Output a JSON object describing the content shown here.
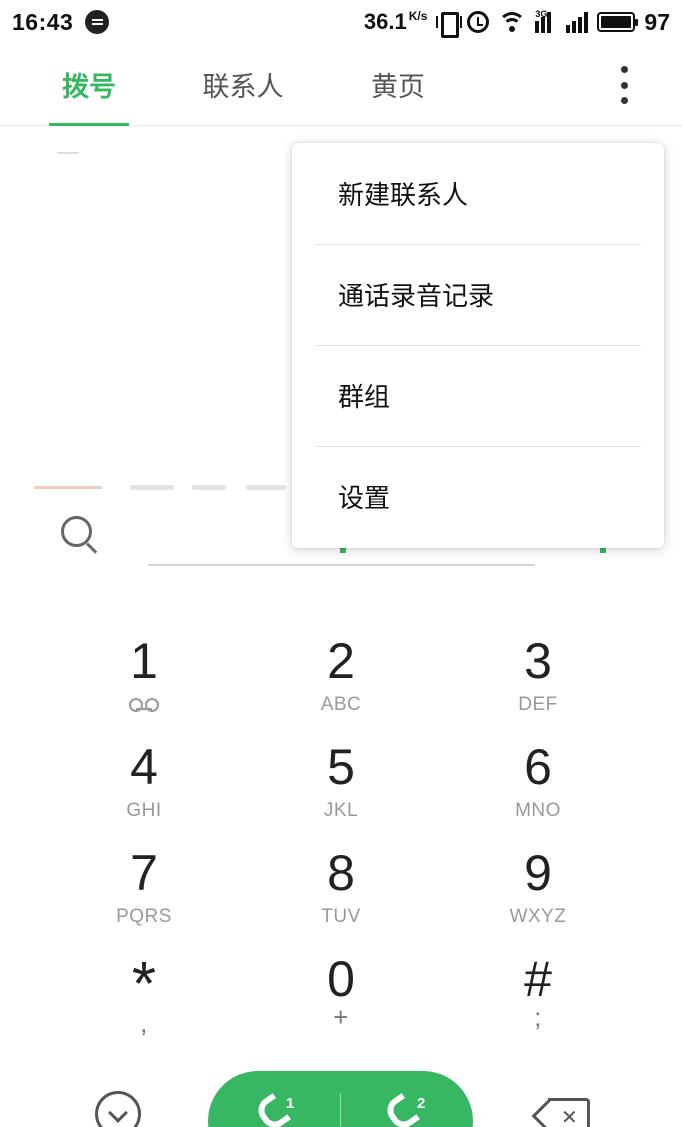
{
  "status_bar": {
    "time": "16:43",
    "net_speed": "36.1",
    "net_unit": "K/s",
    "signal_tag": "3G",
    "battery": "97",
    "battery_level": 0.97
  },
  "tabs": [
    {
      "label": "拨号",
      "active": true
    },
    {
      "label": "联系人",
      "active": false
    },
    {
      "label": "黄页",
      "active": false
    }
  ],
  "dialer": {
    "number": "",
    "keys": [
      {
        "digit": "1",
        "sub": ""
      },
      {
        "digit": "2",
        "sub": "ABC"
      },
      {
        "digit": "3",
        "sub": "DEF"
      },
      {
        "digit": "4",
        "sub": "GHI"
      },
      {
        "digit": "5",
        "sub": "JKL"
      },
      {
        "digit": "6",
        "sub": "MNO"
      },
      {
        "digit": "7",
        "sub": "PQRS"
      },
      {
        "digit": "8",
        "sub": "TUV"
      },
      {
        "digit": "9",
        "sub": "WXYZ"
      },
      {
        "digit": "*",
        "sub": ","
      },
      {
        "digit": "0",
        "sub": "+"
      },
      {
        "digit": "#",
        "sub": ";"
      }
    ],
    "sim_labels": [
      "1",
      "2"
    ]
  },
  "menu": {
    "items": [
      "新建联系人",
      "通话录音记录",
      "群组",
      "设置"
    ]
  },
  "colors": {
    "accent": "#37b761",
    "menu_bg": "#ffffff"
  },
  "icons": {
    "search": "search-icon",
    "more": "more-vertical-icon",
    "collapse": "chevron-down-circle-icon",
    "call": "phone-icon",
    "backspace": "backspace-icon"
  }
}
